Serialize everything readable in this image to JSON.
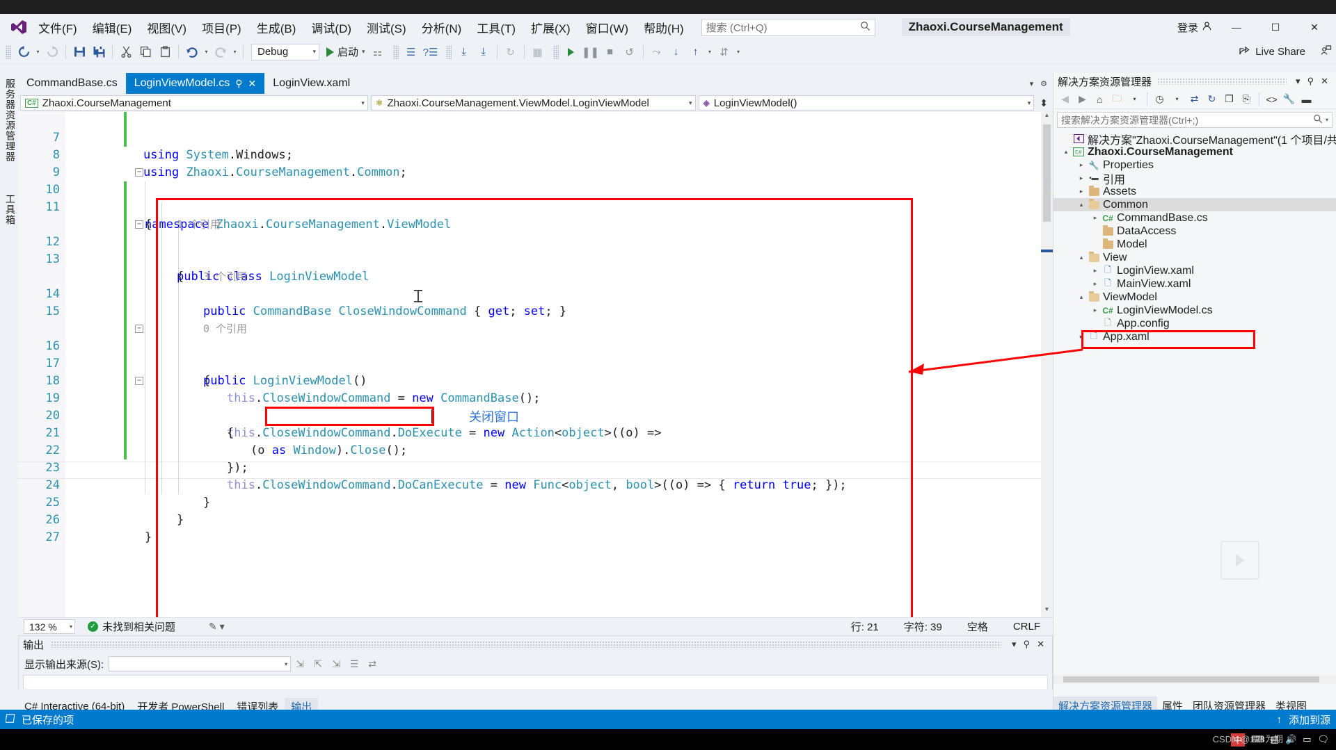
{
  "window": {
    "title": "Zhaoxi.CourseManagement",
    "signin_label": "登录",
    "minimize": "—",
    "maximize": "☐",
    "close": "✕"
  },
  "menu": {
    "items": [
      {
        "label": "文件(F)"
      },
      {
        "label": "编辑(E)"
      },
      {
        "label": "视图(V)"
      },
      {
        "label": "项目(P)"
      },
      {
        "label": "生成(B)"
      },
      {
        "label": "调试(D)"
      },
      {
        "label": "测试(S)"
      },
      {
        "label": "分析(N)"
      },
      {
        "label": "工具(T)"
      },
      {
        "label": "扩展(X)"
      },
      {
        "label": "窗口(W)"
      },
      {
        "label": "帮助(H)"
      }
    ],
    "search_placeholder": "搜索 (Ctrl+Q)"
  },
  "toolbar": {
    "config": "Debug",
    "start_label": "启动",
    "live_share": "Live Share",
    "icons": {
      "back": "◀",
      "forward": "↻",
      "save": "💾",
      "save_all": "🗎",
      "cut": "✂",
      "copy": "❐",
      "paste": "📋",
      "undo": "↶",
      "redo": "↷",
      "play": "▶",
      "pause": "❚❚",
      "stop": "■",
      "restart": "↺",
      "step_over": "⤳",
      "step_into": "↓",
      "step_out": "↑"
    }
  },
  "left_strip": {
    "tabs": [
      "服务器资源管理器",
      "工具箱"
    ]
  },
  "editor": {
    "tabs": [
      {
        "label": "CommandBase.cs",
        "active": false
      },
      {
        "label": "LoginViewModel.cs",
        "active": true
      },
      {
        "label": "LoginView.xaml",
        "active": false
      }
    ],
    "tab_pin": "⚲",
    "tab_close": "✕",
    "nav": {
      "project": "Zhaoxi.CourseManagement",
      "project_icon": "C#",
      "type": "Zhaoxi.CourseManagement.ViewModel.LoginViewModel",
      "member": "LoginViewModel()"
    },
    "lines": [
      {
        "num": "7",
        "text": "using System.Windows;",
        "changed": true
      },
      {
        "num": "8",
        "text": "using Zhaoxi.CourseManagement.Common;",
        "changed": true
      },
      {
        "num": "9",
        "text": "",
        "changed": false
      },
      {
        "num": "10",
        "text": "namespace Zhaoxi.CourseManagement.ViewModel",
        "changed": false,
        "fold": true
      },
      {
        "num": "11",
        "text": "{",
        "changed": false
      },
      {
        "num": "",
        "text": "1 个引用",
        "hint": true
      },
      {
        "num": "12",
        "text": "public class LoginViewModel",
        "changed": true,
        "fold": true
      },
      {
        "num": "13",
        "text": "{",
        "changed": true
      },
      {
        "num": "",
        "text": "3 个引用",
        "hint": true
      },
      {
        "num": "14",
        "text": "public CommandBase CloseWindowCommand { get; set; }",
        "changed": true
      },
      {
        "num": "15",
        "text": "",
        "changed": true
      },
      {
        "num": "",
        "text": "0 个引用",
        "hint": true
      },
      {
        "num": "16",
        "text": "public LoginViewModel()",
        "changed": true,
        "fold": true
      },
      {
        "num": "17",
        "text": "{",
        "changed": true
      },
      {
        "num": "18",
        "text": "this.CloseWindowCommand = new CommandBase();",
        "changed": true
      },
      {
        "num": "19",
        "text": "this.CloseWindowCommand.DoExecute = new Action<object>((o) =>",
        "changed": true,
        "fold": true
      },
      {
        "num": "20",
        "text": "{",
        "changed": true
      },
      {
        "num": "21",
        "text": "(o as Window).Close();",
        "changed": true,
        "current": true
      },
      {
        "num": "22",
        "text": "});",
        "changed": true
      },
      {
        "num": "23",
        "text": "this.CloseWindowCommand.DoCanExecute = new Func<object, bool>((o) => { return true; });",
        "changed": true
      },
      {
        "num": "24",
        "text": "}",
        "changed": true
      },
      {
        "num": "25",
        "text": "}",
        "changed": false
      },
      {
        "num": "26",
        "text": "}",
        "changed": false
      },
      {
        "num": "27",
        "text": "",
        "changed": false
      }
    ],
    "annotation_note": "关闭窗口"
  },
  "editor_status": {
    "zoom": "132 %",
    "issues": "未找到相关问题",
    "issue_icon": "✓",
    "line_label": "行: 21",
    "col_label": "字符: 39",
    "space_label": "空格",
    "eol_label": "CRLF"
  },
  "output": {
    "title": "输出",
    "source_label": "显示输出来源(S):",
    "source_value": "",
    "dropdown_caret": "▾",
    "close": "✕",
    "pin": "⚲",
    "menu": "▾",
    "tools": [
      "⇲",
      "⇱",
      "⇲",
      "☰",
      "⇄"
    ]
  },
  "doc_tabs": [
    {
      "label": "C# Interactive (64-bit)",
      "active": false
    },
    {
      "label": "开发者 PowerShell",
      "active": false
    },
    {
      "label": "错误列表",
      "active": false
    },
    {
      "label": "输出",
      "active": true
    }
  ],
  "solution_explorer": {
    "title": "解决方案资源管理器",
    "menu": "▾",
    "pin": "⚲",
    "close": "✕",
    "search_placeholder": "搜索解决方案资源管理器(Ctrl+;)",
    "toolbar_icons": [
      "◀",
      "▶",
      "⌂",
      "🗀",
      "▾",
      "◷",
      "▾",
      "⇄",
      "↻",
      "❐",
      "⎘",
      "<>",
      "🔧",
      "▬"
    ],
    "tree": [
      {
        "indent": 0,
        "arrow": "",
        "icon": "sln",
        "label": "解决方案\"Zhaoxi.CourseManagement\"(1 个项目/共",
        "bold": false
      },
      {
        "indent": 1,
        "arrow": "▴",
        "icon": "csproj",
        "label": "Zhaoxi.CourseManagement",
        "bold": true
      },
      {
        "indent": 2,
        "arrow": "▸",
        "icon": "props",
        "label": "Properties",
        "bold": false
      },
      {
        "indent": 2,
        "arrow": "▸",
        "icon": "refs",
        "label": "引用",
        "bold": false
      },
      {
        "indent": 2,
        "arrow": "▸",
        "icon": "folder",
        "label": "Assets",
        "bold": false
      },
      {
        "indent": 2,
        "arrow": "▴",
        "icon": "folder",
        "label": "Common",
        "bold": false,
        "selected": true
      },
      {
        "indent": 3,
        "arrow": "▸",
        "icon": "cs",
        "label": "CommandBase.cs",
        "bold": false
      },
      {
        "indent": 3,
        "arrow": "",
        "icon": "folder",
        "label": "DataAccess",
        "bold": false
      },
      {
        "indent": 3,
        "arrow": "",
        "icon": "folder",
        "label": "Model",
        "bold": false
      },
      {
        "indent": 2,
        "arrow": "▴",
        "icon": "folder",
        "label": "View",
        "bold": false
      },
      {
        "indent": 3,
        "arrow": "▸",
        "icon": "xaml",
        "label": "LoginView.xaml",
        "bold": false
      },
      {
        "indent": 3,
        "arrow": "▸",
        "icon": "xaml",
        "label": "MainView.xaml",
        "bold": false
      },
      {
        "indent": 2,
        "arrow": "▴",
        "icon": "folder",
        "label": "ViewModel",
        "bold": false
      },
      {
        "indent": 3,
        "arrow": "▸",
        "icon": "cs",
        "label": "LoginViewModel.cs",
        "bold": false,
        "highlighted": true
      },
      {
        "indent": 3,
        "arrow": "",
        "icon": "config",
        "label": "App.config",
        "bold": false
      },
      {
        "indent": 2,
        "arrow": "▸",
        "icon": "xaml",
        "label": "App.xaml",
        "bold": false
      }
    ],
    "bottom_tabs": [
      {
        "label": "解决方案资源管理器",
        "active": true
      },
      {
        "label": "属性",
        "active": false
      },
      {
        "label": "团队资源管理器",
        "active": false
      },
      {
        "label": "类视图",
        "active": false
      }
    ]
  },
  "status_bar": {
    "saved_label": "已保存的项",
    "add_to_source": "添加到源",
    "up_arrow": "↑"
  },
  "tray": {
    "ime": "中",
    "watermark": "CSDN @123为期"
  },
  "colors": {
    "accent": "#007acc",
    "annotation_red": "#ff0000",
    "note_blue": "#2e75d4",
    "keyword_blue": "#0000ff",
    "type_teal": "#2b91af",
    "changed_green": "#4cc14c"
  }
}
